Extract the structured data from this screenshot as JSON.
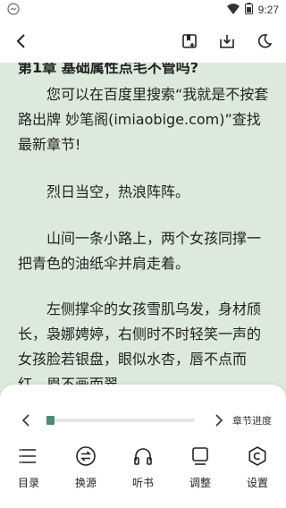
{
  "status": {
    "time": "9:27"
  },
  "toolbar": {
    "back_icon": "back-arrow-icon",
    "icons": [
      "add-bookmark-icon",
      "download-icon",
      "night-mode-icon"
    ]
  },
  "reader": {
    "chapter_title": "第1章 基础属性点毛不管吗?",
    "paragraphs": [
      "您可以在百度里搜索“我就是不按套路出牌 妙笔阁(imiaobige.com)”查找最新章节!",
      "烈日当空，热浪阵阵。",
      "山间一条小路上，两个女孩同撑一把青色的油纸伞并肩走着。",
      "左侧撑伞的女孩雪肌乌发，身材颀长，袅娜娉婷，右侧时不时轻笑一声的女孩脸若银盘，眼似水杏，唇不点而红，眉不画而翠。"
    ],
    "background": "#dde9dc"
  },
  "progress": {
    "label": "章节进度",
    "fraction": 0.02,
    "accent": "#4f8a74"
  },
  "bottom_nav": [
    {
      "label": "目录",
      "icon": "catalog-icon"
    },
    {
      "label": "换源",
      "icon": "switch-source-icon"
    },
    {
      "label": "听书",
      "icon": "headphones-icon"
    },
    {
      "label": "调整",
      "icon": "adjust-icon"
    },
    {
      "label": "设置",
      "icon": "settings-icon"
    }
  ]
}
